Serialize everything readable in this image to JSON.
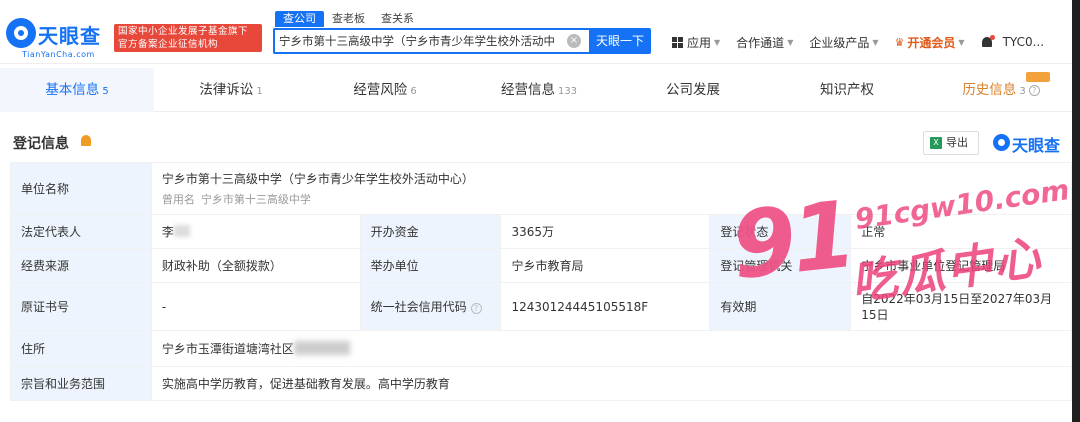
{
  "header": {
    "logo_text": "天眼查",
    "logo_sub": "TianYanCha.com",
    "gov_badge_line1": "国家中小企业发展子基金旗下",
    "gov_badge_line2": "官方备案企业征信机构",
    "search_tabs": [
      "查公司",
      "查老板",
      "查关系"
    ],
    "search_value": "宁乡市第十三高级中学（宁乡市青少年学生校外活动中心）",
    "search_button": "天眼一下",
    "nav": {
      "apps": "应用",
      "channel": "合作通道",
      "enterprise": "企业级产品",
      "vip": "开通会员",
      "user": "TYC0..."
    }
  },
  "tabs": [
    {
      "label": "基本信息",
      "count": "5"
    },
    {
      "label": "法律诉讼",
      "count": "1"
    },
    {
      "label": "经营风险",
      "count": "6"
    },
    {
      "label": "经营信息",
      "count": "133"
    },
    {
      "label": "公司发展",
      "count": ""
    },
    {
      "label": "知识产权",
      "count": ""
    },
    {
      "label": "历史信息",
      "count": "3"
    }
  ],
  "section": {
    "title": "登记信息",
    "export_label": "导出",
    "excel_icon_glyph": "X",
    "brand_text": "天眼查"
  },
  "registration": {
    "unit_name_label": "单位名称",
    "unit_name": "宁乡市第十三高级中学（宁乡市青少年学生校外活动中心）",
    "former_name_tag": "曾用名",
    "former_name": "宁乡市第十三高级中学",
    "legal_rep_label": "法定代表人",
    "legal_rep": "李",
    "capital_label": "开办资金",
    "capital": "3365万",
    "reg_status_label": "登记状态",
    "reg_status": "正常",
    "funding_source_label": "经费来源",
    "funding_source": "财政补助（全额拨款）",
    "sponsor_label": "举办单位",
    "sponsor": "宁乡市教育局",
    "reg_authority_label": "登记管理机关",
    "reg_authority": "宁乡市事业单位登记管理局",
    "certificate_label": "原证书号",
    "certificate": "-",
    "credit_code_label": "统一社会信用代码",
    "credit_code": "12430124445105518F",
    "validity_label": "有效期",
    "validity": "自2022年03月15日至2027年03月15日",
    "address_label": "住所",
    "address": "宁乡市玉潭街道塘湾社区",
    "scope_label": "宗旨和业务范围",
    "scope": "实施高中学历教育，促进基础教育发展。高中学历教育"
  },
  "watermark": {
    "number": "91",
    "url": "91cgw10.com",
    "text": "吃瓜中心"
  }
}
